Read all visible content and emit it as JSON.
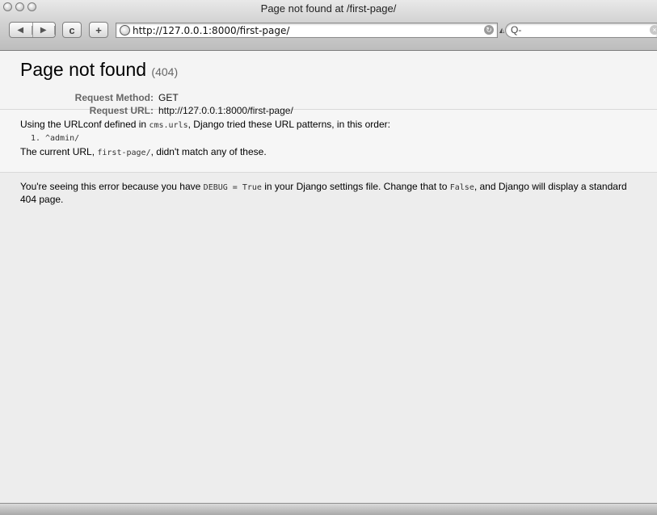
{
  "window": {
    "title": "Page not found at /first-page/"
  },
  "toolbar": {
    "back_icon": "◀",
    "forward_icon": "▶",
    "reload_label": "c",
    "add_label": "+",
    "url": "http://127.0.0.1:8000/first-page/",
    "search_placeholder": "Q-",
    "snapback_icon": "◭"
  },
  "page": {
    "heading": "Page not found",
    "code": "(404)",
    "request_method_label": "Request Method:",
    "request_method_value": "GET",
    "request_url_label": "Request URL:",
    "request_url_value": "http://127.0.0.1:8000/first-page/",
    "urlconf_intro_prefix": "Using the URLconf defined in ",
    "urlconf_module": "cms.urls",
    "urlconf_intro_suffix": ", Django tried these URL patterns, in this order:",
    "patterns": [
      "^admin/"
    ],
    "current_url_prefix": "The current URL, ",
    "current_url": "first-page/",
    "current_url_suffix": ", didn't match any of these.",
    "explain_1": "You're seeing this error because you have ",
    "explain_debug": "DEBUG = True",
    "explain_2": " in your Django settings file. Change that to ",
    "explain_false": "False",
    "explain_3": ", and Django will display a standard 404 page."
  }
}
